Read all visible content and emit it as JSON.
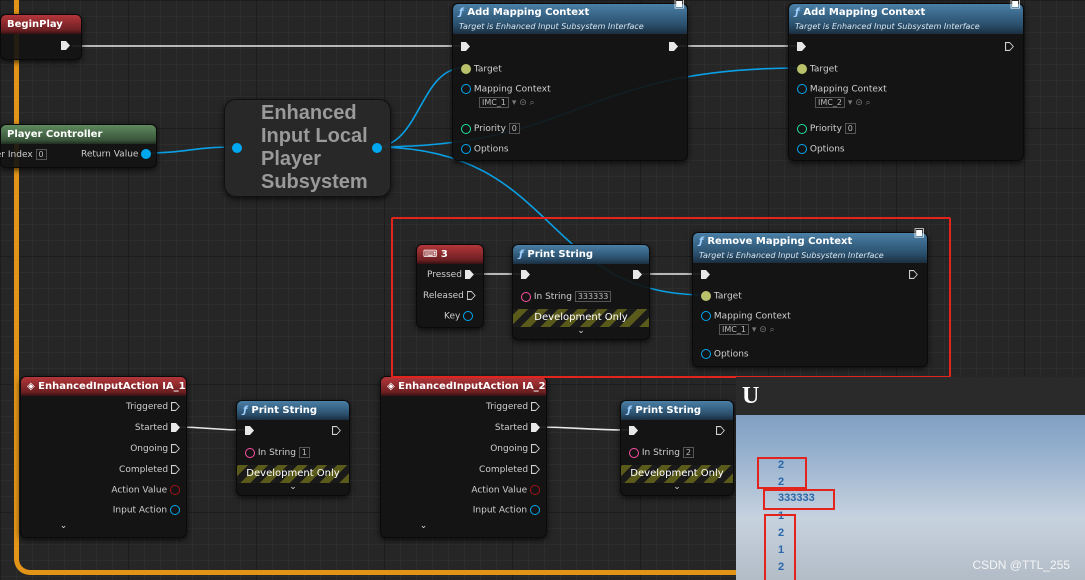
{
  "nodes": {
    "begin_play": {
      "title": "BeginPlay"
    },
    "player_controller": {
      "title": "Player Controller",
      "player_index_label": "Player Index",
      "player_index_value": "0",
      "return_value": "Return Value"
    },
    "subsystem": {
      "title": "Enhanced Input Local Player Subsystem"
    },
    "add_ctx_1": {
      "title": "Add Mapping Context",
      "subtitle": "Target is Enhanced Input Subsystem Interface",
      "target": "Target",
      "mapping_context": "Mapping Context",
      "mapping_value": "IMC_1",
      "priority": "Priority",
      "priority_value": "0",
      "options": "Options"
    },
    "add_ctx_2": {
      "title": "Add Mapping Context",
      "subtitle": "Target is Enhanced Input Subsystem Interface",
      "target": "Target",
      "mapping_context": "Mapping Context",
      "mapping_value": "IMC_2",
      "priority": "Priority",
      "priority_value": "0",
      "options": "Options"
    },
    "key_3": {
      "title": "3",
      "pressed": "Pressed",
      "released": "Released",
      "key": "Key"
    },
    "print_mid": {
      "title": "Print String",
      "in_string": "In String",
      "in_value": "333333",
      "dev": "Development Only"
    },
    "remove_ctx": {
      "title": "Remove Mapping Context",
      "subtitle": "Target is Enhanced Input Subsystem Interface",
      "target": "Target",
      "mapping_context": "Mapping Context",
      "mapping_value": "IMC_1",
      "options": "Options"
    },
    "ia_1": {
      "title": "EnhancedInputAction IA_1",
      "triggered": "Triggered",
      "started": "Started",
      "ongoing": "Ongoing",
      "completed": "Completed",
      "action_value": "Action Value",
      "input_action": "Input Action"
    },
    "print_1": {
      "title": "Print String",
      "in_string": "In String",
      "in_value": "1",
      "dev": "Development Only"
    },
    "ia_2": {
      "title": "EnhancedInputAction IA_2",
      "triggered": "Triggered",
      "started": "Started",
      "ongoing": "Ongoing",
      "completed": "Completed",
      "action_value": "Action Value",
      "input_action": "Input Action"
    },
    "print_2": {
      "title": "Print String",
      "in_string": "In String",
      "in_value": "2",
      "dev": "Development Only"
    }
  },
  "viewport": {
    "logo": "U",
    "log_lines": [
      "2",
      "2",
      "333333",
      "1",
      "2",
      "1",
      "2"
    ]
  },
  "watermark": "CSDN @TTL_255",
  "colors": {
    "highlight_box": "#e3241d",
    "comment_border": "#e29418",
    "wire_object": "#0aa0e6",
    "wire_exec": "#ffffff"
  }
}
